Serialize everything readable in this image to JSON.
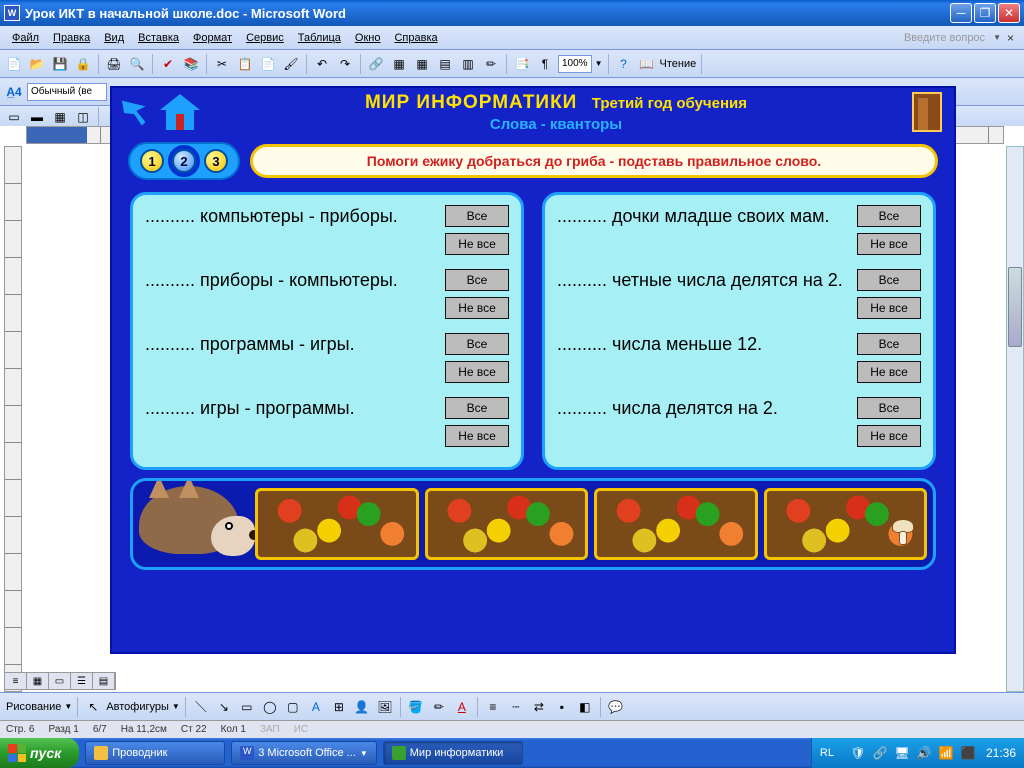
{
  "window": {
    "title": "Урок ИКТ в начальной школе.doc - Microsoft Word",
    "app_icon_letter": "W"
  },
  "menu": {
    "items": [
      "Файл",
      "Правка",
      "Вид",
      "Вставка",
      "Формат",
      "Сервис",
      "Таблица",
      "Окно",
      "Справка"
    ],
    "question_hint": "Введите вопрос"
  },
  "toolbar": {
    "zoom": "100%",
    "reading": "Чтение",
    "style": "Обычный (ве"
  },
  "drawbar": {
    "label": "Рисование",
    "autoshapes": "Автофигуры"
  },
  "status": {
    "page": "Стр. 6",
    "section": "Разд 1",
    "pages": "6/7",
    "pos": "На 11,2см",
    "line": "Ст 22",
    "col": "Кол 1",
    "rec": "ЗАП",
    "fix": "ИС",
    "lang": "RL"
  },
  "taskbar": {
    "start": "пуск",
    "explorer": "Проводник",
    "word": "3 Microsoft Office ...",
    "app": "Мир информатики",
    "time": "21:36"
  },
  "embed": {
    "title": "МИР ИНФОРМАТИКИ",
    "title2": "Третий год обучения",
    "subtitle": "Слова - кванторы",
    "nums": [
      "1",
      "2",
      "3"
    ],
    "active_num": 1,
    "instruction": "Помоги ежику добраться до гриба - подставь правильное слово.",
    "btn_all": "Все",
    "btn_notall": "Не все",
    "left": [
      "..........   компьютеры - приборы.",
      "..........   приборы - компьютеры.",
      "..........   программы - игры.",
      "..........   игры - программы."
    ],
    "right": [
      "..........   дочки младше своих мам.",
      "..........   четные числа делятся на 2.",
      "..........   числа меньше 12.",
      "..........   числа делятся на 2."
    ]
  }
}
